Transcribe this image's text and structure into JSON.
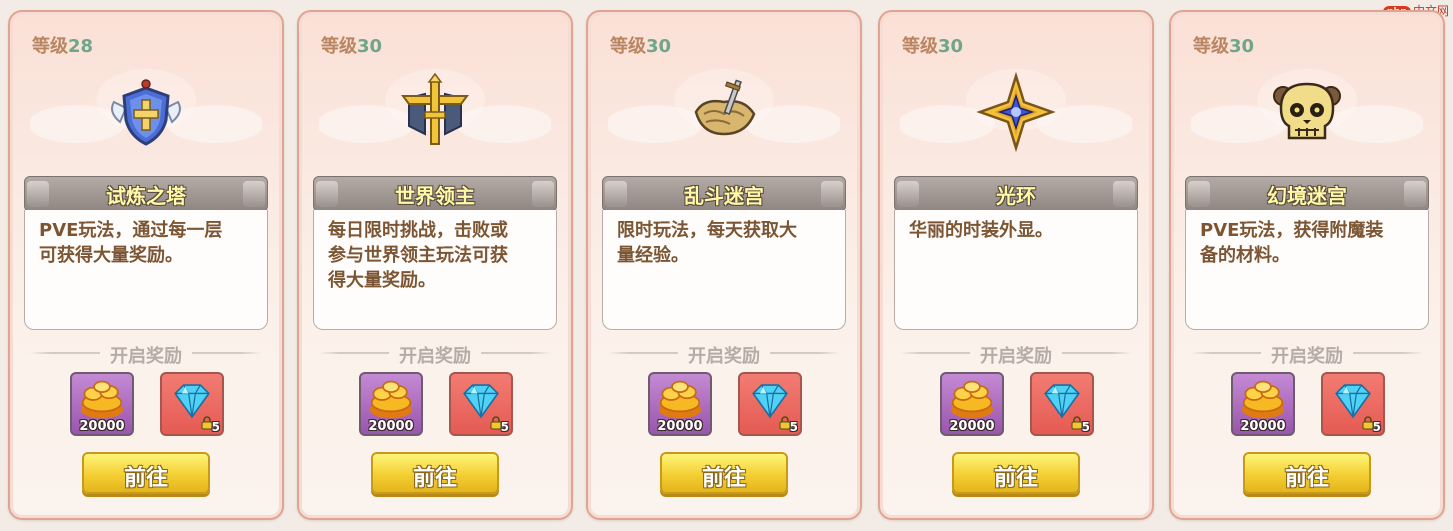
{
  "level_label": "等级",
  "rewards_header": "开启奖励",
  "go_label": "前往",
  "watermark": {
    "logo": "php",
    "text": "中文网"
  },
  "cards": [
    {
      "level": "28",
      "emblem": "shield-cross-icon",
      "title": "试炼之塔",
      "desc_line1": "PVE玩法，通过每一层",
      "desc_line2": "可获得大量奖励。",
      "desc_line3": "",
      "gold_qty": "20000",
      "gem_count": "5"
    },
    {
      "level": "30",
      "emblem": "golden-sword-crest-icon",
      "title": "世界领主",
      "desc_line1": "每日限时挑战，击败或",
      "desc_line2": "参与世界领主玩法可获",
      "desc_line3": "得大量奖励。",
      "gold_qty": "20000",
      "gem_count": "5"
    },
    {
      "level": "30",
      "emblem": "map-sword-icon",
      "title": "乱斗迷宫",
      "desc_line1": "限时玩法，每天获取大",
      "desc_line2": "量经验。",
      "desc_line3": "",
      "gold_qty": "20000",
      "gem_count": "5"
    },
    {
      "level": "30",
      "emblem": "star-halo-icon",
      "title": "光环",
      "desc_line1": "华丽的时装外显。",
      "desc_line2": "",
      "desc_line3": "",
      "gold_qty": "20000",
      "gem_count": "5"
    },
    {
      "level": "30",
      "emblem": "skull-icon",
      "title": "幻境迷宫",
      "desc_line1": "PVE玩法，获得附魔装",
      "desc_line2": "备的材料。",
      "desc_line3": "",
      "gold_qty": "20000",
      "gem_count": "5"
    }
  ],
  "colors": {
    "card_border": "#e0a591",
    "level_label": "#b98560",
    "level_number": "#6fa68a",
    "title_text": "#fff9a8",
    "desc_text": "#7c5634",
    "button_yellow": "#f3cf33"
  }
}
